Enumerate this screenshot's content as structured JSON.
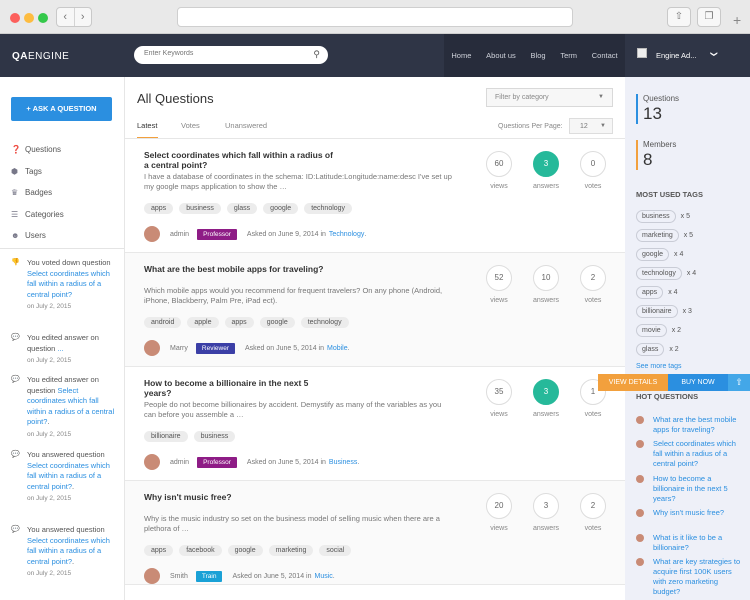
{
  "header": {
    "logo_bold": "QA",
    "logo_rest": "ENGINE",
    "search_placeholder": "Enter Keywords",
    "nav": [
      "Home",
      "About us",
      "Blog",
      "Term",
      "Contact"
    ],
    "user_name": "Engine Ad...",
    "user_caret": "❯"
  },
  "sidebar": {
    "ask_label": "ASK A QUESTION",
    "items": [
      {
        "label": "Questions",
        "icon": "question-circle-icon"
      },
      {
        "label": "Tags",
        "icon": "tag-icon"
      },
      {
        "label": "Badges",
        "icon": "trophy-icon"
      },
      {
        "label": "Categories",
        "icon": "list-icon"
      },
      {
        "label": "Users",
        "icon": "users-icon"
      }
    ],
    "activity": [
      {
        "text": "You voted down question",
        "link": "Select coordinates which fall within a radius of a central point?",
        "suffix": "",
        "date": "on July 2, 2015",
        "icon": "thumbs-down-icon"
      },
      {
        "text": "You edited answer on question",
        "link": "",
        "suffix": "...",
        "date": "on July 2, 2015",
        "icon": "comments-icon"
      },
      {
        "text": "You edited answer on question",
        "link": "Select coordinates which fall within a radius of a central point?",
        "suffix": ".",
        "date": "on July 2, 2015",
        "icon": "comments-icon"
      },
      {
        "text": "You answered question",
        "link": "Select coordinates which fall within a radius of a central point?",
        "suffix": ".",
        "date": "on July 2, 2015",
        "icon": "comments-icon"
      },
      {
        "text": "You answered question",
        "link": "Select coordinates which fall within a radius of a central point?",
        "suffix": ".",
        "date": "on July 2, 2015",
        "icon": "comments-icon"
      }
    ]
  },
  "main": {
    "title": "All Questions",
    "filter_label": "Filter by category",
    "filter_caret": "▼",
    "tabs": [
      "Latest",
      "Votes",
      "Unanswered"
    ],
    "per_page_label": "Questions Per Page:",
    "per_page_value": "12",
    "stat_labels": {
      "views": "views",
      "answers": "answers",
      "votes": "votes"
    },
    "questions": [
      {
        "title": "Select coordinates which fall within a radius of a central point?",
        "desc": "I have a database of coordinates in the schema: ID:Latitude:Longitude:name:desc I've set up my google maps application to show the …",
        "tags": [
          "apps",
          "business",
          "glass",
          "google",
          "technology"
        ],
        "author": "admin",
        "badge": "Professor",
        "badge_color": "#8e1c86",
        "asked": "Asked on June 9, 2014 in",
        "category": "Technology",
        "suffix": ".",
        "views": "60",
        "answers": "3",
        "votes": "0",
        "answered": true
      },
      {
        "title": "What are the best mobile apps for traveling?",
        "desc": "Which mobile apps would you recommend for frequent travelers? On any phone (Android, iPhone, Blackberry, Palm Pre, iPad ect).",
        "tags": [
          "android",
          "apple",
          "apps",
          "google",
          "technology"
        ],
        "author": "Marry",
        "badge": "Reviewer",
        "badge_color": "#3b3fa6",
        "asked": "Asked on June 5, 2014 in",
        "category": "Mobile",
        "suffix": ".",
        "views": "52",
        "answers": "10",
        "votes": "2",
        "answered": false
      },
      {
        "title": "How to become a billionaire in the next 5 years?",
        "desc": "People do not become billionaires by accident. Demystify as many of the variables as you can before you assemble a …",
        "tags": [
          "billionaire",
          "business"
        ],
        "author": "admin",
        "badge": "Professor",
        "badge_color": "#8e1c86",
        "asked": "Asked on June 5, 2014 in",
        "category": "Business",
        "suffix": ".",
        "views": "35",
        "answers": "3",
        "votes": "1",
        "answered": true
      },
      {
        "title": "Why isn't music free?",
        "desc": "Why is the music industry so set on the business model of selling music when there are a plethora of …",
        "tags": [
          "apps",
          "facebook",
          "google",
          "marketing",
          "social"
        ],
        "author": "Smith",
        "badge": "Train",
        "badge_color": "#1aa1d6",
        "asked": "Asked on June 5, 2014 in",
        "category": "Music",
        "suffix": ".",
        "views": "20",
        "answers": "3",
        "votes": "2",
        "answered": false
      }
    ]
  },
  "right": {
    "questions_label": "Questions",
    "questions_count": "13",
    "members_label": "Members",
    "members_count": "8",
    "tags_heading": "MOST USED TAGS",
    "tags": [
      {
        "name": "business",
        "count": "x 5"
      },
      {
        "name": "marketing",
        "count": "x 5"
      },
      {
        "name": "google",
        "count": "x 4"
      },
      {
        "name": "technology",
        "count": "x 4"
      },
      {
        "name": "apps",
        "count": "x 4"
      },
      {
        "name": "billionaire",
        "count": "x 3"
      },
      {
        "name": "movie",
        "count": "x 2"
      },
      {
        "name": "glass",
        "count": "x 2"
      }
    ],
    "see_more": "See more tags",
    "view_details": "VIEW DETAILS",
    "buy_now": "BUY NOW",
    "hot_heading": "HOT QUESTIONS",
    "hot": [
      "What are the best mobile apps for traveling?",
      "Select coordinates which fall within a radius of a central point?",
      "How to become a billionaire in the next 5 years?",
      "Why isn't music free?",
      "What is it like to be a billionaire?",
      "What are key strategies to acquire first 100K users with zero marketing budget?"
    ]
  },
  "colors": {
    "accent": "#2b8fe0",
    "answered": "#26b99a",
    "orange": "#f2a03d",
    "topbar": "#2f3546"
  }
}
